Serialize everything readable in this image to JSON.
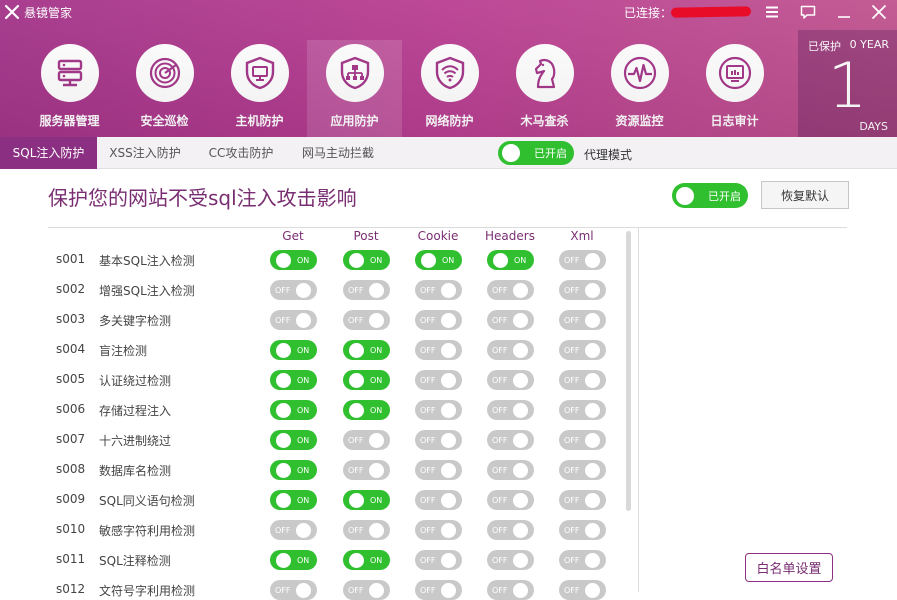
{
  "app": {
    "title": "悬镜管家",
    "connection_label": "已连接："
  },
  "window_controls": [
    "menu-icon",
    "feedback-icon",
    "minimize-icon",
    "close-icon"
  ],
  "nav": {
    "active_index": 3,
    "items": [
      {
        "label": "服务器管理",
        "icon": "server-icon"
      },
      {
        "label": "安全巡检",
        "icon": "scan-icon"
      },
      {
        "label": "主机防护",
        "icon": "host-shield-icon"
      },
      {
        "label": "应用防护",
        "icon": "app-shield-icon"
      },
      {
        "label": "网络防护",
        "icon": "wifi-shield-icon"
      },
      {
        "label": "木马查杀",
        "icon": "horse-icon"
      },
      {
        "label": "资源监控",
        "icon": "pulse-icon"
      },
      {
        "label": "日志审计",
        "icon": "report-icon"
      }
    ]
  },
  "protection": {
    "label": "已保护",
    "years": "0 YEAR",
    "days": "1",
    "days_unit": "DAYS"
  },
  "tabs": {
    "active_index": 0,
    "items": [
      "SQL注入防护",
      "XSS注入防护",
      "CC攻击防护",
      "网马主动拦截"
    ]
  },
  "master_toggle": {
    "state": "on",
    "text": "已开启"
  },
  "proxy_mode_label": "代理模式",
  "main": {
    "title": "保护您的网站不受sql注入攻击影响",
    "toggle": {
      "state": "on",
      "text": "已开启"
    },
    "restore_label": "恢复默认",
    "whitelist_label": "白名单设置",
    "columns": [
      "Get",
      "Post",
      "Cookie",
      "Headers",
      "Xml"
    ],
    "on_text": "ON",
    "off_text": "OFF",
    "rules": [
      {
        "id": "s001",
        "name": "基本SQL注入检测",
        "states": [
          true,
          true,
          true,
          true,
          false
        ]
      },
      {
        "id": "s002",
        "name": "增强SQL注入检测",
        "states": [
          false,
          false,
          false,
          false,
          false
        ]
      },
      {
        "id": "s003",
        "name": "多关键字检测",
        "states": [
          false,
          false,
          false,
          false,
          false
        ]
      },
      {
        "id": "s004",
        "name": "盲注检测",
        "states": [
          true,
          true,
          false,
          false,
          false
        ]
      },
      {
        "id": "s005",
        "name": "认证绕过检测",
        "states": [
          true,
          true,
          false,
          false,
          false
        ]
      },
      {
        "id": "s006",
        "name": "存储过程注入",
        "states": [
          true,
          true,
          false,
          false,
          false
        ]
      },
      {
        "id": "s007",
        "name": "十六进制绕过",
        "states": [
          true,
          false,
          false,
          false,
          false
        ]
      },
      {
        "id": "s008",
        "name": "数据库名检测",
        "states": [
          true,
          false,
          false,
          false,
          false
        ]
      },
      {
        "id": "s009",
        "name": "SQL同义语句检测",
        "states": [
          true,
          true,
          false,
          false,
          false
        ]
      },
      {
        "id": "s010",
        "name": "敏感字符利用检测",
        "states": [
          false,
          false,
          false,
          false,
          false
        ]
      },
      {
        "id": "s011",
        "name": "SQL注释检测",
        "states": [
          true,
          true,
          false,
          false,
          false
        ]
      },
      {
        "id": "s012",
        "name": "文符号字利用检测",
        "states": [
          false,
          false,
          false,
          false,
          false
        ]
      }
    ]
  },
  "colors": {
    "header_primary": "#a43489",
    "accent_purple": "#8b2f83",
    "toggle_on": "#2fbf2f",
    "toggle_off": "#c9c9c9",
    "redaction": "#e8001e"
  }
}
